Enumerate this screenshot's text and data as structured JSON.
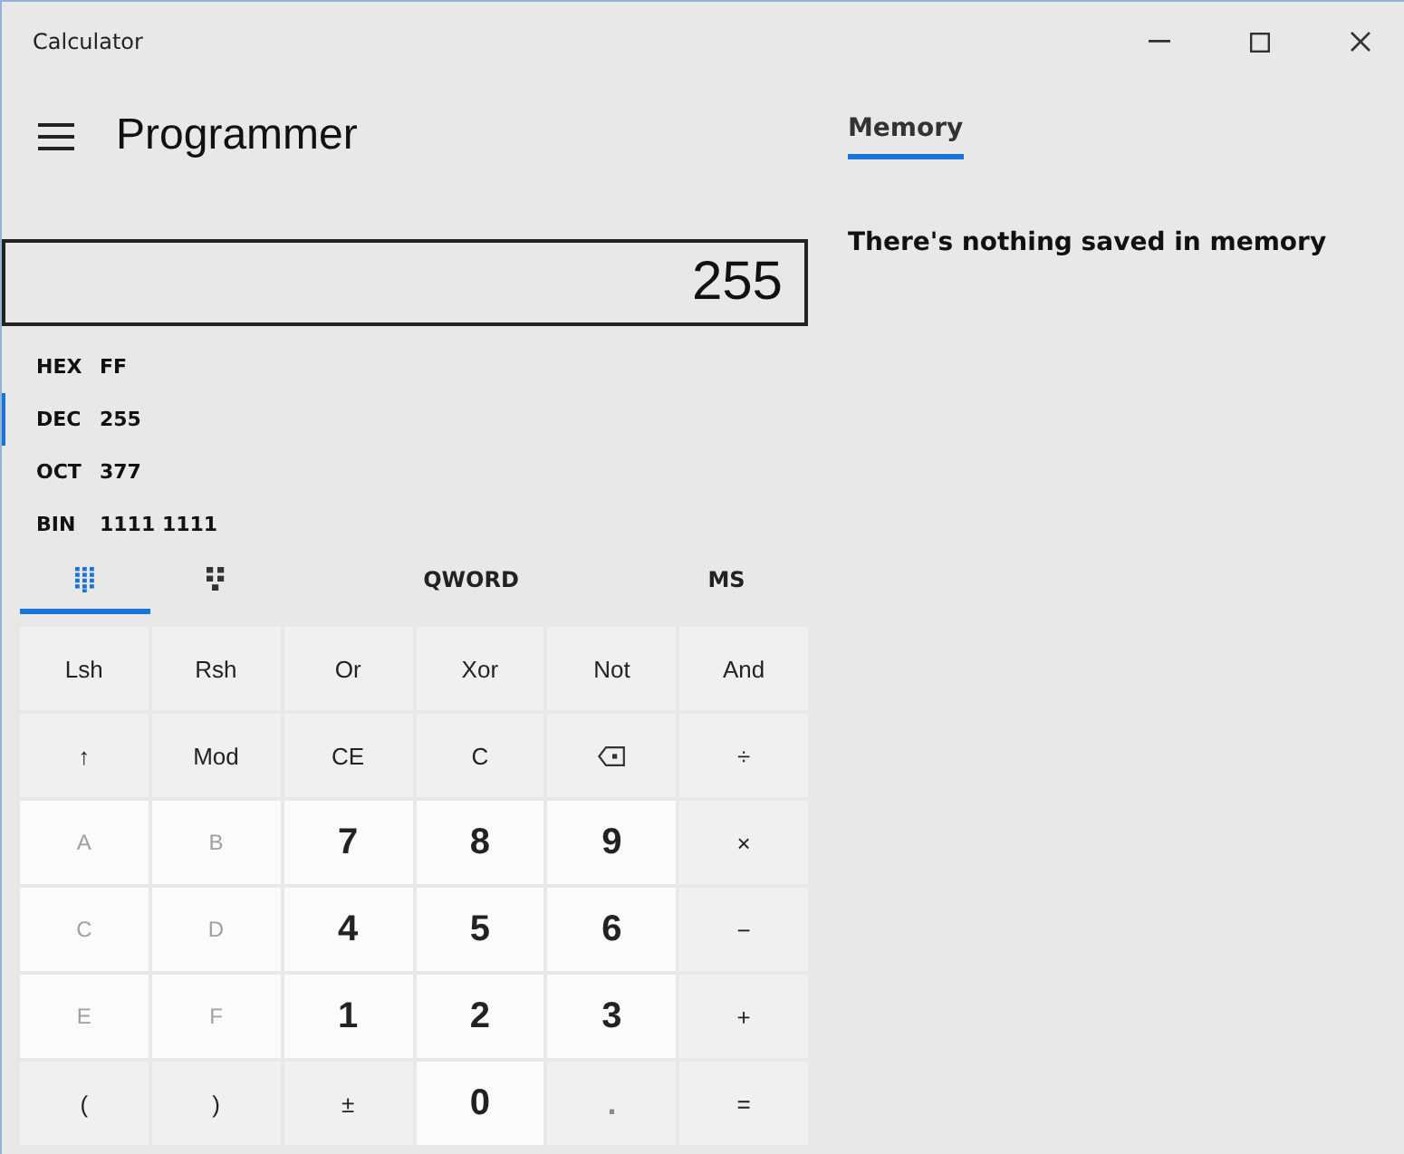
{
  "window": {
    "title": "Calculator"
  },
  "header": {
    "mode": "Programmer"
  },
  "memory_panel": {
    "tab": {
      "label": "Memory",
      "selected": true
    },
    "message": "There's nothing saved in memory"
  },
  "display": {
    "value": "255"
  },
  "radix": [
    {
      "label": "HEX",
      "value": "FF",
      "selected": false
    },
    {
      "label": "DEC",
      "value": "255",
      "selected": true
    },
    {
      "label": "OCT",
      "value": "377",
      "selected": false
    },
    {
      "label": "BIN",
      "value": "1111 1111",
      "selected": false
    }
  ],
  "toolbar": [
    {
      "kind": "keypad",
      "selected": true
    },
    {
      "kind": "bits",
      "selected": false
    },
    {
      "kind": "text",
      "label": "QWORD",
      "selected": false
    },
    {
      "kind": "text",
      "label": "MS",
      "selected": false
    }
  ],
  "keys": [
    {
      "label": "Lsh",
      "kind": "op",
      "disabled": false
    },
    {
      "label": "Rsh",
      "kind": "op",
      "disabled": false
    },
    {
      "label": "Or",
      "kind": "op",
      "disabled": false
    },
    {
      "label": "Xor",
      "kind": "op",
      "disabled": false
    },
    {
      "label": "Not",
      "kind": "op",
      "disabled": false
    },
    {
      "label": "And",
      "kind": "op",
      "disabled": false
    },
    {
      "label": "↑",
      "kind": "op",
      "disabled": false
    },
    {
      "label": "Mod",
      "kind": "op",
      "disabled": false
    },
    {
      "label": "CE",
      "kind": "op",
      "disabled": false
    },
    {
      "label": "C",
      "kind": "op",
      "disabled": false
    },
    {
      "kind": "backspace",
      "disabled": false
    },
    {
      "label": "÷",
      "kind": "op",
      "disabled": false
    },
    {
      "label": "A",
      "kind": "digit",
      "disabled": true
    },
    {
      "label": "B",
      "kind": "digit",
      "disabled": true
    },
    {
      "label": "7",
      "kind": "digit",
      "disabled": false
    },
    {
      "label": "8",
      "kind": "digit",
      "disabled": false
    },
    {
      "label": "9",
      "kind": "digit",
      "disabled": false
    },
    {
      "label": "×",
      "kind": "op",
      "disabled": false
    },
    {
      "label": "C",
      "kind": "digit",
      "disabled": true
    },
    {
      "label": "D",
      "kind": "digit",
      "disabled": true
    },
    {
      "label": "4",
      "kind": "digit",
      "disabled": false
    },
    {
      "label": "5",
      "kind": "digit",
      "disabled": false
    },
    {
      "label": "6",
      "kind": "digit",
      "disabled": false
    },
    {
      "label": "−",
      "kind": "op",
      "disabled": false
    },
    {
      "label": "E",
      "kind": "digit",
      "disabled": true
    },
    {
      "label": "F",
      "kind": "digit",
      "disabled": true
    },
    {
      "label": "1",
      "kind": "digit",
      "disabled": false
    },
    {
      "label": "2",
      "kind": "digit",
      "disabled": false
    },
    {
      "label": "3",
      "kind": "digit",
      "disabled": false
    },
    {
      "label": "+",
      "kind": "op",
      "disabled": false
    },
    {
      "label": "(",
      "kind": "op",
      "disabled": false
    },
    {
      "label": ")",
      "kind": "op",
      "disabled": false
    },
    {
      "label": "±",
      "kind": "op",
      "disabled": false
    },
    {
      "label": "0",
      "kind": "digit",
      "disabled": false
    },
    {
      "label": ".",
      "kind": "op",
      "disabled": true
    },
    {
      "label": "=",
      "kind": "op",
      "disabled": false
    }
  ]
}
